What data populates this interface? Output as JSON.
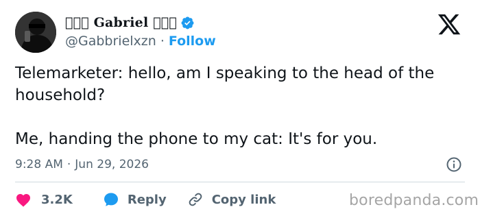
{
  "author": {
    "display_name": "\u0000\u0000☘ Gabriel ☘\u0000\u0000",
    "handle": "@Gabbrielxzn",
    "separator": "·",
    "follow_label": "Follow",
    "verified": true
  },
  "tweet": {
    "paragraphs": [
      "Telemarketer: hello, am I speaking to the head of the household?",
      "Me, handing the phone to my cat: It's for you."
    ],
    "time": "9:28 AM",
    "separator": "·",
    "date": "Jun 29, 2026"
  },
  "actions": {
    "like_count": "3.2K",
    "reply_label": "Reply",
    "copy_link_label": "Copy link"
  },
  "watermark": "boredpanda.com",
  "colors": {
    "text": "#0f1419",
    "secondary": "#536471",
    "accent": "#1d9bf0",
    "like": "#f91880",
    "divider": "#cfd9de"
  },
  "icons": {
    "verified": "verified-badge-icon",
    "logo": "x-logo-icon",
    "info": "info-icon",
    "like": "heart-icon",
    "reply": "speech-bubble-icon",
    "copy": "link-icon"
  }
}
